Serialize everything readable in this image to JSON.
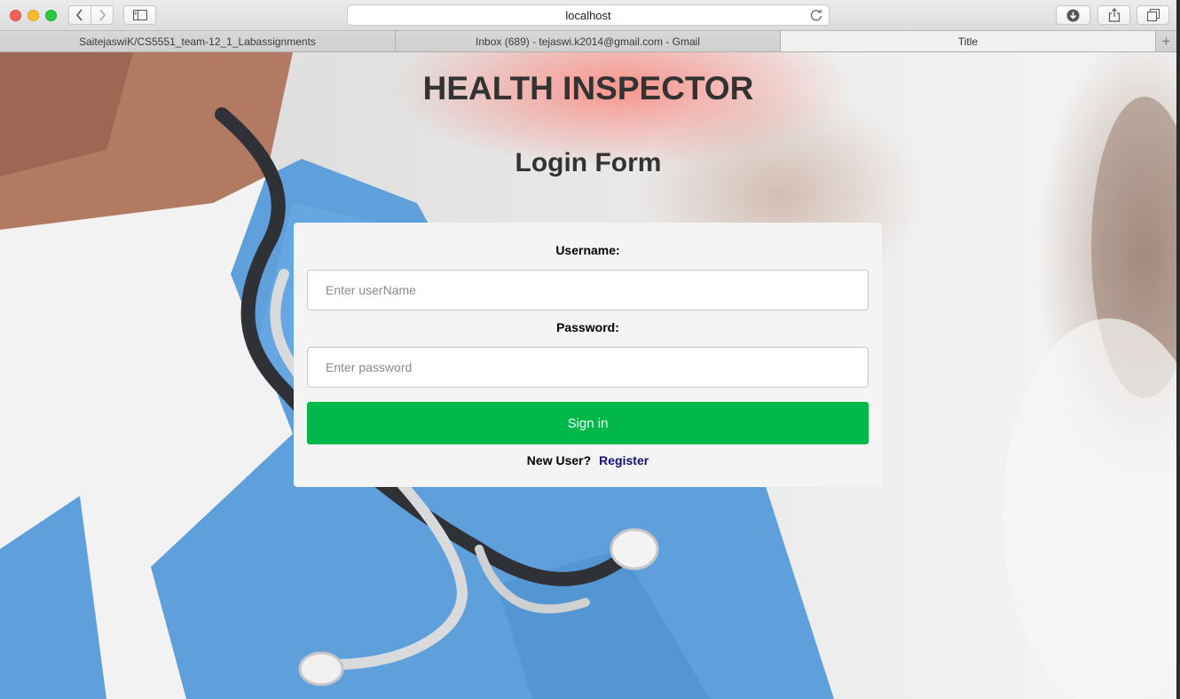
{
  "browser": {
    "address": "localhost",
    "tabs": [
      {
        "label": "SaitejaswiK/CS5551_team-12_1_Labassignments",
        "active": false
      },
      {
        "label": "Inbox (689) - tejaswi.k2014@gmail.com - Gmail",
        "active": false
      },
      {
        "label": "Title",
        "active": true
      }
    ],
    "new_tab_label": "+"
  },
  "page": {
    "title": "HEALTH INSPECTOR",
    "subtitle": "Login Form",
    "form": {
      "username_label": "Username:",
      "username_placeholder": "Enter userName",
      "password_label": "Password:",
      "password_placeholder": "Enter password",
      "signin_label": "Sign in",
      "new_user_text": "New User?",
      "register_label": "Register"
    }
  },
  "colors": {
    "signin_button": "#00b74a",
    "register_link": "#14107a",
    "card_background": "#f4f4f4",
    "scrubs": "#5e9fdc"
  }
}
